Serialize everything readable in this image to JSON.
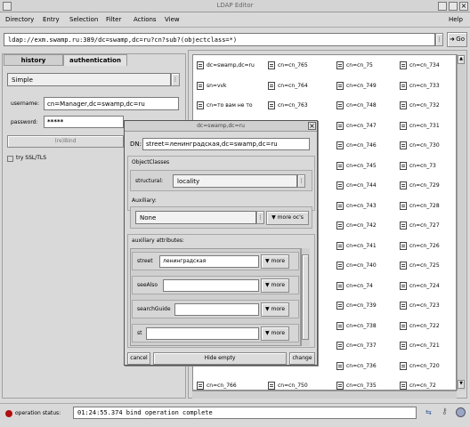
{
  "window": {
    "title": "LDAP Editor"
  },
  "menu": [
    "Directory",
    "Entry",
    "Selection",
    "Filter",
    "Actions",
    "View",
    "Help"
  ],
  "url": {
    "value": "ldap://exm.swamp.ru:389/dc=swamp,dc=ru?cn?sub?(objectclass=*)",
    "go_label": "Go"
  },
  "tabs": {
    "history": "history",
    "authentication": "authentication"
  },
  "auth": {
    "method": "Simple",
    "username_label": "username:",
    "username": "cn=Manager,dc=swamp,dc=ru",
    "password_label": "password:",
    "password": "*****",
    "bind_label": "(re)Bind",
    "ssl_label": "try SSL/TLS"
  },
  "entries": [
    [
      "dc=swamp,dc=ru",
      "cn=cn_765",
      "cn=cn_75",
      "cn=cn_734"
    ],
    [
      "sn=vvk",
      "cn=cn_764",
      "cn=cn_749",
      "cn=cn_733"
    ],
    [
      "cn=то вам не то",
      "cn=cn_763",
      "cn=cn_748",
      "cn=cn_732"
    ],
    [
      "",
      "",
      "cn=cn_747",
      "cn=cn_731"
    ],
    [
      "",
      "",
      "cn=cn_746",
      "cn=cn_730"
    ],
    [
      "",
      "",
      "cn=cn_745",
      "cn=cn_73"
    ],
    [
      "",
      "",
      "cn=cn_744",
      "cn=cn_729"
    ],
    [
      "",
      "",
      "cn=cn_743",
      "cn=cn_728"
    ],
    [
      "",
      "",
      "cn=cn_742",
      "cn=cn_727"
    ],
    [
      "",
      "",
      "cn=cn_741",
      "cn=cn_726"
    ],
    [
      "",
      "",
      "cn=cn_740",
      "cn=cn_725"
    ],
    [
      "",
      "",
      "cn=cn_74",
      "cn=cn_724"
    ],
    [
      "",
      "",
      "cn=cn_739",
      "cn=cn_723"
    ],
    [
      "",
      "",
      "cn=cn_738",
      "cn=cn_722"
    ],
    [
      "",
      "",
      "cn=cn_737",
      "cn=cn_721"
    ],
    [
      "",
      "",
      "cn=cn_736",
      "cn=cn_720"
    ],
    [
      "",
      "cn=cn_766",
      "cn=cn_750",
      "cn=cn_735",
      "cn=cn_72"
    ]
  ],
  "dialog": {
    "title": "dc=swamp,dc=ru",
    "dn_label": "DN:",
    "dn": "street=ленинградская,dc=swamp,dc=ru",
    "objectclasses_label": "ObjectClasses",
    "structural_label": "structural:",
    "structural": "locality",
    "auxiliary_label": "Auxiliary:",
    "auxiliary": "None",
    "more_oc_label": "more oc's",
    "aux_attrs_label": "auxiliary attributes:",
    "attributes": [
      {
        "name": "street",
        "value": "ленинградская",
        "more": "more"
      },
      {
        "name": "seeAlso",
        "value": "",
        "more": "more"
      },
      {
        "name": "searchGuide",
        "value": "",
        "more": "more"
      },
      {
        "name": "st",
        "value": "",
        "more": "more"
      }
    ],
    "cancel_label": "cancel",
    "hide_empty_label": "Hide empty",
    "change_label": "change"
  },
  "status": {
    "label": "operation status:",
    "message": "01:24:55.374 bind operation complete"
  }
}
